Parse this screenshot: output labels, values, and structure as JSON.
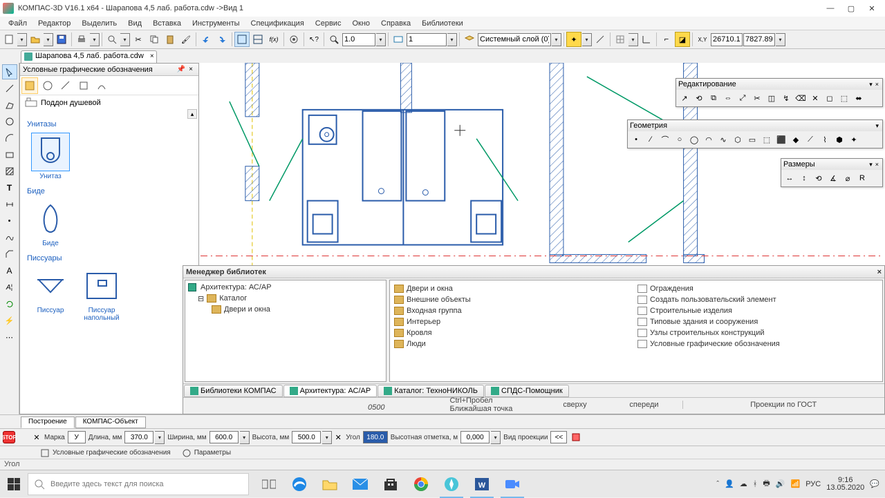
{
  "window": {
    "title": "КОМПАС-3D V16.1 x64 - Шарапова 4,5 лаб. работа.cdw ->Вид 1"
  },
  "menu": [
    "Файл",
    "Редактор",
    "Выделить",
    "Вид",
    "Вставка",
    "Инструменты",
    "Спецификация",
    "Сервис",
    "Окно",
    "Справка",
    "Библиотеки"
  ],
  "toolbar": {
    "scale": "1.0",
    "page": "1",
    "layer": "Системный слой (0)",
    "coord_x": "26710.1",
    "coord_y": "7827.89"
  },
  "doc_tab": {
    "label": "Шарапова 4,5 лаб. работа.cdw"
  },
  "lib_panel": {
    "title": "Условные графические обозначения",
    "shelf_label": "Поддон душевой",
    "cats": {
      "unitaz": "Унитазы",
      "bide": "Биде",
      "pissuar": "Писсуары"
    },
    "items": {
      "unitaz": "Унитаз",
      "bide": "Биде",
      "pissuar1": "Писсуар",
      "pissuar2": "Писсуар напольный"
    }
  },
  "float": {
    "edit": "Редактирование",
    "geom": "Геометрия",
    "dim": "Размеры"
  },
  "libmgr": {
    "title": "Менеджер библиотек",
    "tree": {
      "root": "Архитектура: АС/АР",
      "n1": "Каталог",
      "n2": "Двери и окна"
    },
    "col1": [
      "Двери и окна",
      "Внешние объекты",
      "Входная группа",
      "Интерьер",
      "Кровля",
      "Люди"
    ],
    "col2": [
      "Ограждения",
      "Создать пользовательский элемент",
      "Строительные изделия",
      "Типовые здания и сооружения",
      "Узлы строительных конструкций",
      "Условные графические обозначения"
    ],
    "tabs": {
      "t1": "Библиотеки КОМПАС",
      "t2": "Архитектура: АС/АР",
      "t3": "Каталог: ТехноНИКОЛЬ",
      "t4": "СПДС-Помощник"
    },
    "foot": {
      "s": "сверху",
      "f": "спереди",
      "p": "Проекции по ГОСТ"
    }
  },
  "canvas_overlay": {
    "dim_value": "0500",
    "hint1": "Ctrl+Пробел",
    "hint2": "Ближайшая точка"
  },
  "prop": {
    "tabs": {
      "t1": "Построение",
      "t2": "КОМПАС-Объект"
    },
    "l_marka": "Марка",
    "v_marka": "У",
    "l_dlina": "Длина, мм",
    "v_dlina": "370.0",
    "l_shirina": "Ширина, мм",
    "v_shirina": "600.0",
    "l_vysota": "Высота, мм",
    "v_vysota": "500.0",
    "l_ugol": "Угол",
    "v_ugol": "180.0",
    "l_otm": "Высотная отметка, м",
    "v_otm": "0,000",
    "l_vid": "Вид проекции",
    "btn_vid": "<<",
    "chip1": "Условные графические обозначения",
    "chip2": "Параметры"
  },
  "status": {
    "text": "Угол"
  },
  "taskbar": {
    "search_ph": "Введите здесь текст для поиска",
    "lang": "РУС",
    "time": "9:16",
    "date": "13.05.2020"
  }
}
